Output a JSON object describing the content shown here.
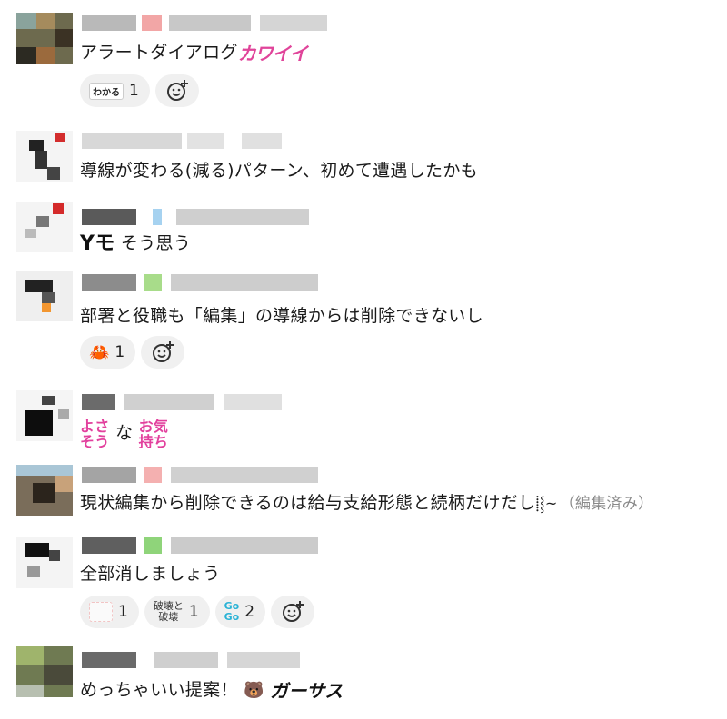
{
  "messages": [
    {
      "text": "アラートダイアログ",
      "stamp": "カワイイ",
      "reactions": [
        {
          "icon_label": "わかる",
          "icon": "wakaru-stamp-icon",
          "count": "1"
        }
      ]
    },
    {
      "text": "導線が変わる(減る)パターン、初めて遭遇したかも"
    },
    {
      "text": "そう思う",
      "stamp_before": "Yモ"
    },
    {
      "text": "部署と役職も「編集」の導線からは削除できないし",
      "reactions": [
        {
          "icon_label": "🦀",
          "icon": "crab-icon",
          "count": "1"
        }
      ]
    },
    {
      "stamp_a_lines": [
        "よさ",
        "そう"
      ],
      "text": "な",
      "stamp_b_lines": [
        "お気",
        "持ち"
      ]
    },
    {
      "text": "現状編集から削除できるのは給与支給形態と続柄だけだし",
      "stamp": "⸽⸾~",
      "edited": "（編集済み）"
    },
    {
      "text": "全部消しましょう",
      "reactions": [
        {
          "icon": "blank-stamp-icon",
          "count": "1"
        },
        {
          "icon_lines": [
            "破壊と",
            "破壊"
          ],
          "icon": "hakai-stamp-icon",
          "count": "1"
        },
        {
          "icon_lines": [
            "Go",
            "Go"
          ],
          "icon": "gogo-stamp-icon",
          "count": "2"
        }
      ]
    },
    {
      "text": "めっちゃいい提案！",
      "stamp_a": "🐻",
      "stamp_b": "ガーサス"
    }
  ],
  "colors": {
    "pill_bg": "#f0f0f0",
    "edited_text": "#8a8a8a",
    "stamp_pink": "#e2409d"
  }
}
